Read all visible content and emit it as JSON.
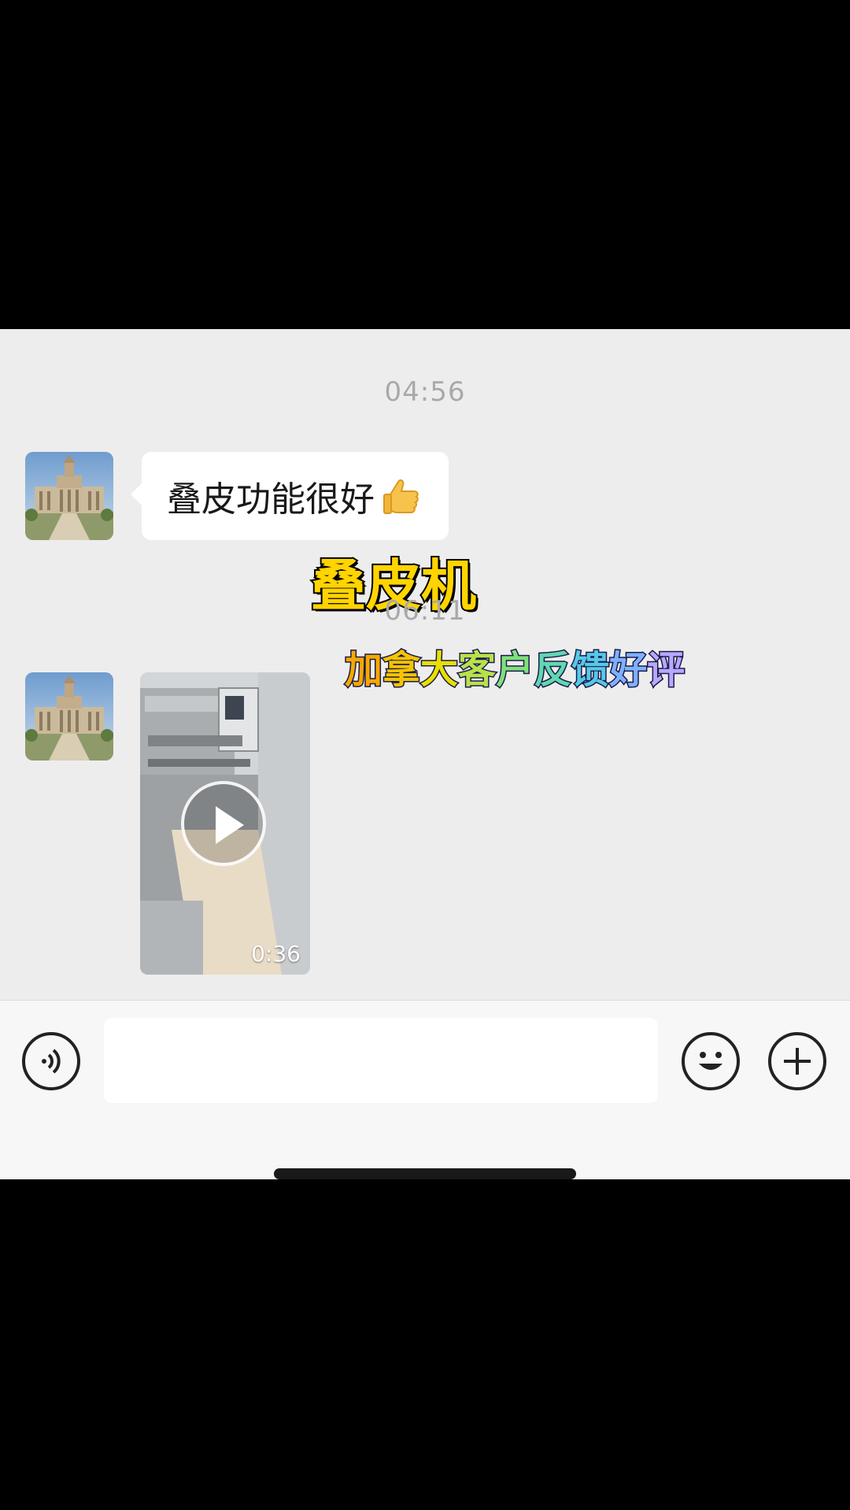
{
  "chat": {
    "timestamps": [
      "04:56",
      "06:11"
    ],
    "message_text": "叠皮功能很好",
    "message_emoji": "thumbs-up-icon",
    "video_duration": "0:36"
  },
  "overlay": {
    "title": "叠皮机",
    "subtitle_chars": [
      "加",
      "拿",
      "大",
      "客",
      "户",
      "反",
      "馈",
      "好",
      "评"
    ],
    "subtitle_colors": [
      "#f6a800",
      "#f5c400",
      "#e8e000",
      "#b8e24a",
      "#7fe07a",
      "#5fd8b0",
      "#56c8e8",
      "#7fb0ff",
      "#b8a8ff"
    ]
  },
  "input_bar": {
    "voice_icon": "voice-icon",
    "emoji_icon": "smiley-icon",
    "add_icon": "plus-icon"
  }
}
